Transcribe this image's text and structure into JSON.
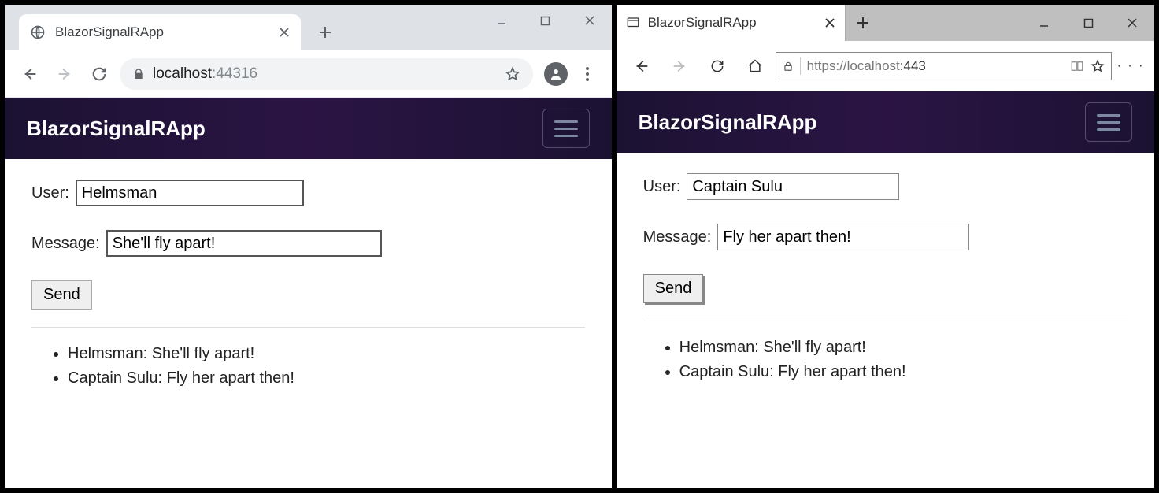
{
  "left": {
    "browser": "chrome",
    "tab_title": "BlazorSignalRApp",
    "url_host": "localhost",
    "url_port": ":44316",
    "app_title": "BlazorSignalRApp",
    "user_label": "User:",
    "user_value": "Helmsman",
    "message_label": "Message:",
    "message_value": "She'll fly apart!",
    "send_label": "Send",
    "messages": [
      "Helmsman: She'll fly apart!",
      "Captain Sulu: Fly her apart then!"
    ]
  },
  "right": {
    "browser": "edge",
    "tab_title": "BlazorSignalRApp",
    "url_text_prefix": "https://",
    "url_host": "localhost",
    "url_port": ":443",
    "app_title": "BlazorSignalRApp",
    "user_label": "User:",
    "user_value": "Captain Sulu",
    "message_label": "Message:",
    "message_value": "Fly her apart then!",
    "send_label": "Send",
    "messages": [
      "Helmsman: She'll fly apart!",
      "Captain Sulu: Fly her apart then!"
    ]
  }
}
